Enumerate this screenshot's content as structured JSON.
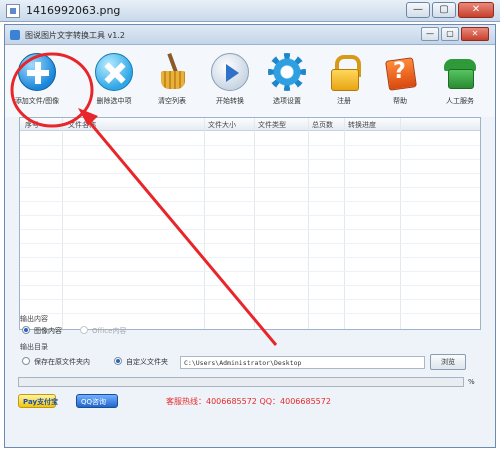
{
  "outer_window": {
    "title": "1416992063.png",
    "buttons": [
      "—",
      "▢",
      "✕"
    ]
  },
  "app_window": {
    "title": "图说图片文字转换工具 v1.2",
    "buttons": [
      "—",
      "▢",
      "✕"
    ]
  },
  "toolbar": [
    {
      "label": "添加文件/图像",
      "icon": "add-icon"
    },
    {
      "label": "删除选中项",
      "icon": "delete-icon"
    },
    {
      "label": "清空列表",
      "icon": "broom-icon"
    },
    {
      "label": "开始转换",
      "icon": "play-icon"
    },
    {
      "label": "选项设置",
      "icon": "gear-icon"
    },
    {
      "label": "注册",
      "icon": "lock-icon"
    },
    {
      "label": "帮助",
      "icon": "help-icon"
    },
    {
      "label": "人工服务",
      "icon": "phone-icon"
    }
  ],
  "file_list": {
    "columns": [
      "序号",
      "文件名称",
      "文件大小",
      "文件类型",
      "总页数",
      "转换进度"
    ],
    "rows": []
  },
  "recognition": {
    "label": "输出内容",
    "options": [
      {
        "label": "图像内容",
        "selected": true,
        "enabled": true
      },
      {
        "label": "Office内容",
        "selected": false,
        "enabled": false
      }
    ]
  },
  "output": {
    "label": "输出目录",
    "options": [
      {
        "label": "保存在原文件夹内",
        "selected": false
      },
      {
        "label": "自定义文件夹",
        "selected": true
      }
    ],
    "path": "C:\\Users\\Administrator\\Desktop",
    "browse_label": "浏览"
  },
  "progress": {
    "value": 0,
    "label": "%"
  },
  "footer": {
    "pay_label": "Pay支付宝",
    "qq_label": "QQ咨询",
    "contact": "客服热线：4006685572 QQ：4006685572"
  },
  "colors": {
    "annotation": "#e8262a",
    "accent": "#1b86d9"
  }
}
